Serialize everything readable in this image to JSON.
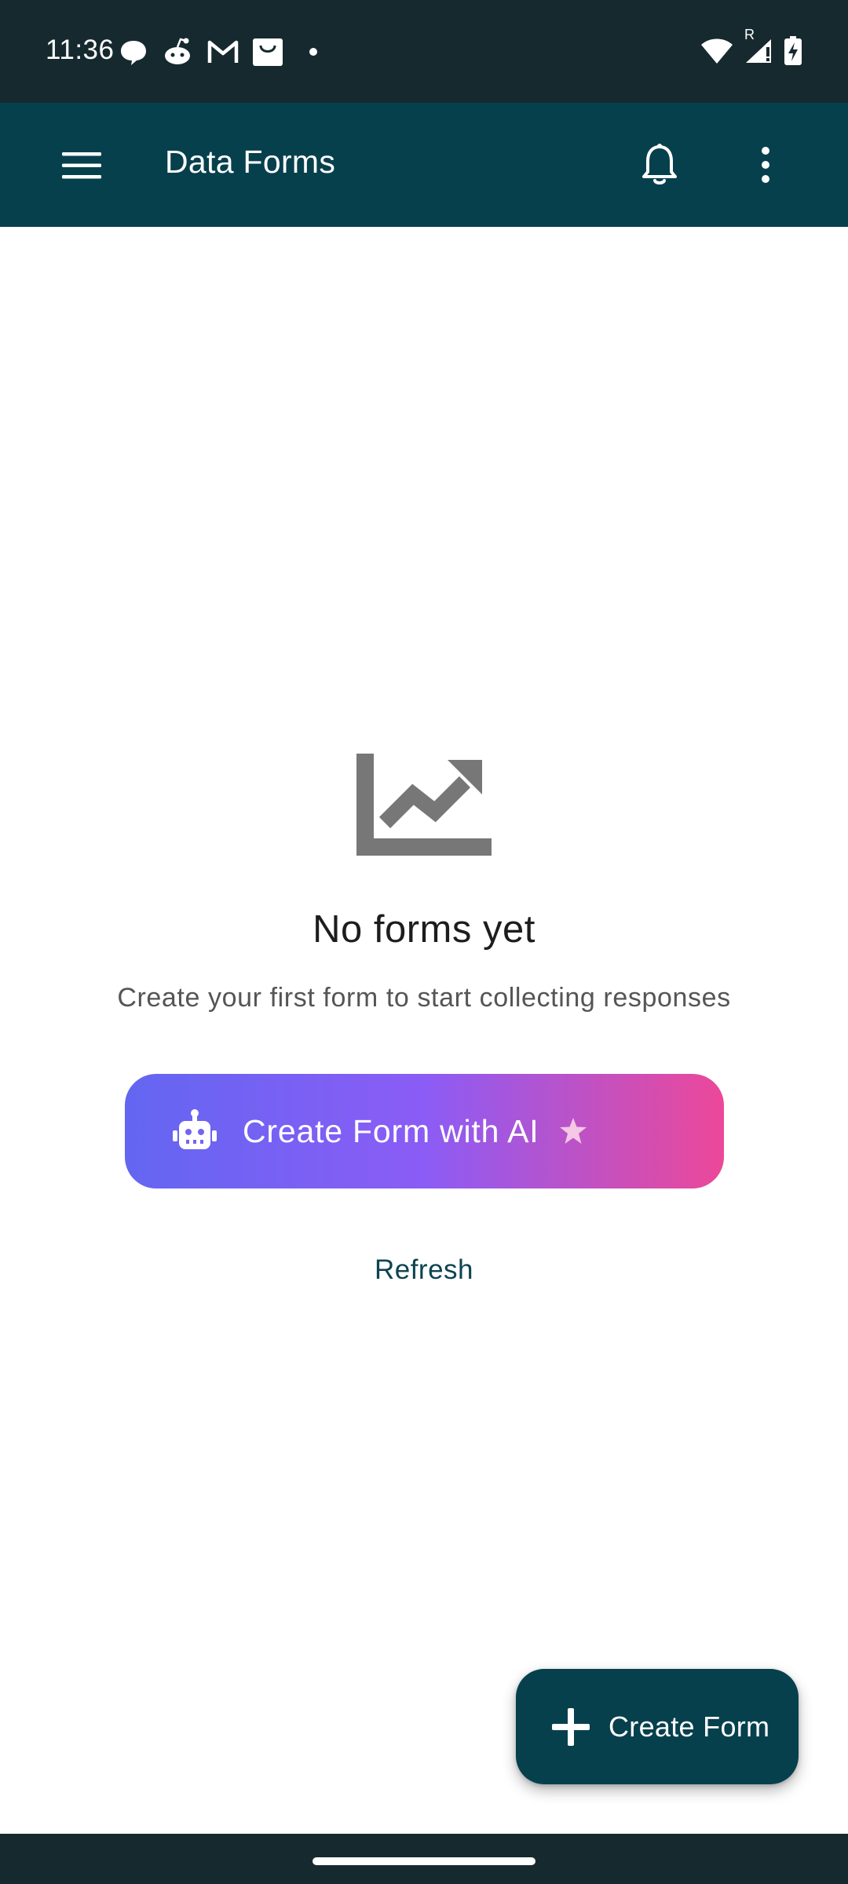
{
  "status_bar": {
    "time": "11:36",
    "notification_icons": [
      "chat-bubble-icon",
      "reddit-icon",
      "gmail-icon",
      "shopping-bag-icon",
      "more-dot-icon"
    ],
    "status_icons": [
      "wifi-icon",
      "signal-roaming-icon",
      "battery-charging-icon"
    ],
    "roaming_label": "R"
  },
  "app_bar": {
    "title": "Data Forms",
    "icons": [
      "menu-icon",
      "bell-icon",
      "more-vert-icon"
    ]
  },
  "empty_state": {
    "icon": "trending-up-chart-icon",
    "title": "No forms yet",
    "subtitle": "Create your first form to start collecting responses",
    "ai_button": {
      "label": "Create Form with AI",
      "icon": "robot-icon",
      "trailing_icon": "star-icon",
      "gradient": [
        "#6366f1",
        "#8b5cf6",
        "#ec4899"
      ]
    },
    "refresh_label": "Refresh"
  },
  "fab": {
    "label": "Create Form",
    "icon": "plus-icon"
  },
  "colors": {
    "status_bar": "#16292f",
    "app_bar": "#07404d",
    "background": "#ffffff",
    "empty_icon": "#777777",
    "refresh_text": "#0d4452"
  }
}
